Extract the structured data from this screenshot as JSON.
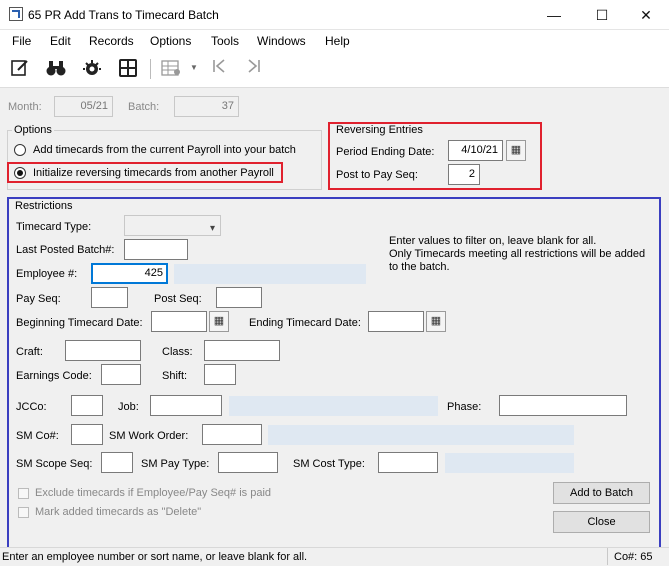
{
  "window": {
    "title": "65 PR Add Trans to Timecard Batch",
    "controls": {
      "minimize": "—",
      "maximize": "☐",
      "close": "✕"
    }
  },
  "menu": [
    "File",
    "Edit",
    "Records",
    "Options",
    "Tools",
    "Windows",
    "Help"
  ],
  "toolbar": {
    "icons": [
      "edit-icon",
      "binoculars-icon",
      "settings-icon",
      "calculator-icon",
      "grid-settings-icon",
      "first-record-icon",
      "last-record-icon"
    ]
  },
  "header": {
    "month_label": "Month:",
    "month_value": "05/21",
    "batch_label": "Batch:",
    "batch_value": "37"
  },
  "options": {
    "title": "Options",
    "radio_current": "Add timecards from the current Payroll into your batch",
    "radio_reversing": "Initialize reversing timecards from another Payroll",
    "selected": "reversing"
  },
  "reversing": {
    "title": "Reversing Entries",
    "period_label": "Period Ending Date:",
    "period_value": "4/10/21",
    "post_label": "Post to Pay Seq:",
    "post_value": "2"
  },
  "restrictions": {
    "title": "Restrictions",
    "info_line1": "Enter values to filter on, leave blank for all.",
    "info_line2": "Only Timecards meeting all restrictions will be added",
    "info_line3": "to the batch.",
    "timecard_type_label": "Timecard Type:",
    "last_posted_label": "Last Posted Batch#:",
    "employee_label": "Employee #:",
    "employee_value": "425",
    "pay_seq_label": "Pay Seq:",
    "post_seq_label": "Post Seq:",
    "begin_date_label": "Beginning Timecard Date:",
    "end_date_label": "Ending Timecard Date:",
    "craft_label": "Craft:",
    "class_label": "Class:",
    "earnings_label": "Earnings Code:",
    "shift_label": "Shift:",
    "jcco_label": "JCCo:",
    "job_label": "Job:",
    "phase_label": "Phase:",
    "smco_label": "SM Co#:",
    "sm_work_order_label": "SM Work Order:",
    "sm_scope_label": "SM Scope Seq:",
    "sm_pay_type_label": "SM Pay Type:",
    "sm_cost_type_label": "SM Cost Type:",
    "exclude_label": "Exclude timecards if Employee/Pay Seq# is paid",
    "mark_delete_label": "Mark added timecards as \"Delete\""
  },
  "buttons": {
    "add_to_batch": "Add to Batch",
    "close": "Close"
  },
  "status": {
    "message": "Enter an employee number or sort name, or leave blank for all.",
    "company": "Co#: 65"
  },
  "colors": {
    "highlight_red": "#e0212e",
    "highlight_blue": "#3b3fc0",
    "accent": "#0078d7"
  }
}
